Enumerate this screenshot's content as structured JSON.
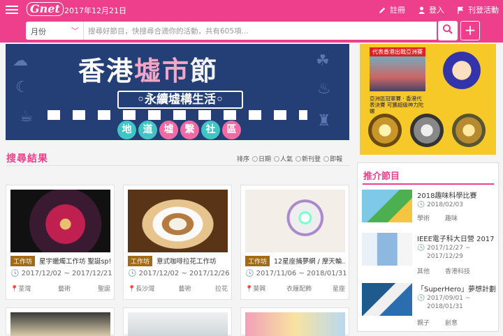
{
  "header": {
    "logo": "Gnet",
    "date": "2017年12月21日",
    "nav": [
      {
        "label": "註冊",
        "icon": "pencil-icon"
      },
      {
        "label": "登入",
        "icon": "user-icon"
      },
      {
        "label": "刊登活動",
        "icon": "flag-icon"
      }
    ]
  },
  "search": {
    "select_value": "月份",
    "placeholder": "搜尋好節目，快搜尋合適你的活動，共有605項...",
    "search_icon": "search-icon",
    "add_label": "+"
  },
  "banner": {
    "title_a": "香港",
    "title_b": "墟市",
    "title_c": "節",
    "subtitle": "◦永續墟構生活◦",
    "chips": [
      "地",
      "道",
      "墟",
      "繫",
      "社",
      "區"
    ]
  },
  "ad": {
    "header": "代表香港出戰亞洲賽",
    "caption": "亞洲區冠軍賽 · 香港代表決賽 可獲超級神力陀螺"
  },
  "results": {
    "title": "搜尋結果",
    "sort_label": "排序",
    "sort_options": [
      "日期",
      "人氣",
      "新刊登",
      "即報"
    ]
  },
  "cards": [
    {
      "tag": "工作坊",
      "title": "星宇蠟燭工作坊 聖誕sp!",
      "date": "2017/12/02 ~ 2017/12/21",
      "location": "荃灣",
      "category": "藝術",
      "extra": "聖誕"
    },
    {
      "tag": "工作坊",
      "title": "意式咖啡拉花工作坊",
      "date": "2017/12/02 ~ 2017/12/26",
      "location": "長沙灣",
      "category": "藝術",
      "extra": "拉花"
    },
    {
      "tag": "工作坊",
      "title": "12星座捕夢網 / 摩天輪...",
      "date": "2017/11/06 ~ 2018/01/31",
      "location": "葵興",
      "category": "衣履配飾",
      "extra": "星座"
    }
  ],
  "recommend": {
    "title": "推介節目",
    "items": [
      {
        "title": "2018趣味科學比賽",
        "date_from": "2018/02/03",
        "date_to": "",
        "cat1": "學術",
        "cat2": "趣味"
      },
      {
        "title": "IEEE電子科大日營 2017",
        "date_from": "2017/12/27 ~",
        "date_to": "2017/12/29",
        "cat1": "其他",
        "cat2": "香港科技"
      },
      {
        "title": "「SuperHero」夢想計劃",
        "date_from": "2017/09/01 ~",
        "date_to": "2018/01/31",
        "cat1": "親子",
        "cat2": "創意"
      }
    ]
  },
  "colors": {
    "brand": "#ee3f8c",
    "tag": "#a26a16",
    "banner": "#233f75"
  }
}
